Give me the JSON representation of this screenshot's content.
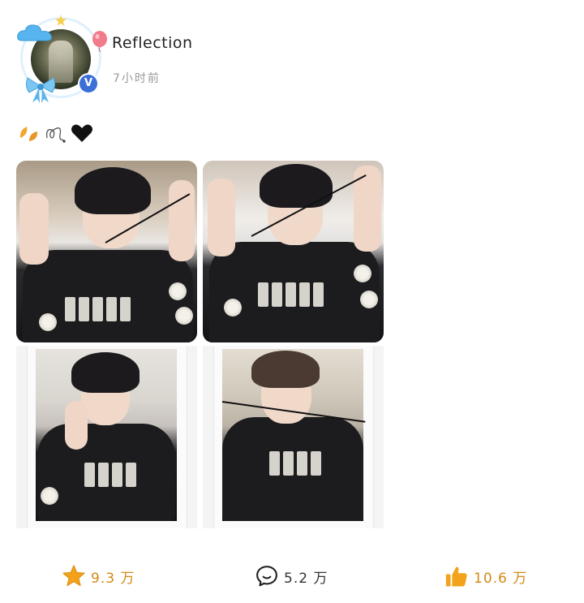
{
  "post": {
    "username": "Reflection",
    "time": "7小时前",
    "verified_badge": "V",
    "content_emojis": [
      "leaves-emoji",
      "bow-doodle-emoji",
      "black-heart-emoji"
    ],
    "photos": [
      {
        "name": "photo-1"
      },
      {
        "name": "photo-2"
      },
      {
        "name": "photo-3"
      },
      {
        "name": "photo-4"
      }
    ]
  },
  "actions": {
    "favorite": {
      "icon": "star-icon",
      "count": "9.3 万"
    },
    "comment": {
      "icon": "comment-icon",
      "count": "5.2 万"
    },
    "like": {
      "icon": "thumbs-up-icon",
      "count": "10.6 万"
    }
  },
  "colors": {
    "accent": "#f2a31b",
    "count_text": "#d38a14",
    "comment_text": "#333333",
    "time_text": "#9a9a9a",
    "verified": "#3d6fd8"
  }
}
